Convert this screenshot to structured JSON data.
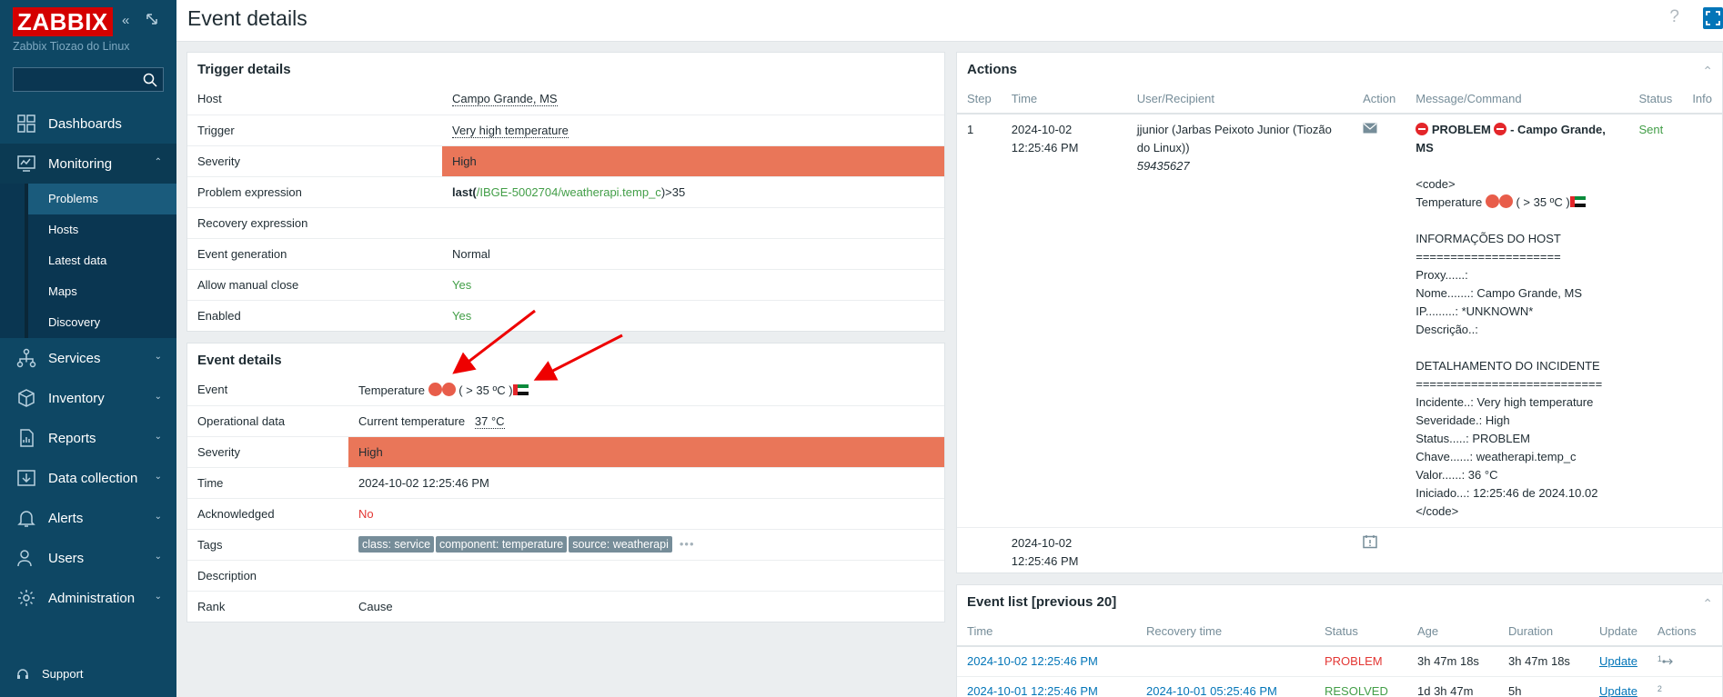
{
  "sidebar": {
    "logo": "ZABBIX",
    "server_name": "Zabbix Tiozao do Linux",
    "search_placeholder": "",
    "menu": [
      {
        "label": "Dashboards",
        "icon": "dashboards-icon"
      },
      {
        "label": "Monitoring",
        "icon": "monitoring-icon"
      },
      {
        "label": "Services",
        "icon": "services-icon"
      },
      {
        "label": "Inventory",
        "icon": "inventory-icon"
      },
      {
        "label": "Reports",
        "icon": "reports-icon"
      },
      {
        "label": "Data collection",
        "icon": "data-collection-icon"
      },
      {
        "label": "Alerts",
        "icon": "alerts-icon"
      },
      {
        "label": "Users",
        "icon": "users-icon"
      },
      {
        "label": "Administration",
        "icon": "administration-icon"
      }
    ],
    "monitoring_sub": [
      "Problems",
      "Hosts",
      "Latest data",
      "Maps",
      "Discovery"
    ],
    "support": "Support"
  },
  "header": {
    "title": "Event details"
  },
  "trigger": {
    "title": "Trigger details",
    "rows": {
      "host_label": "Host",
      "host_value": "Campo Grande, MS",
      "trigger_label": "Trigger",
      "trigger_value": "Very high temperature",
      "severity_label": "Severity",
      "severity_value": "High",
      "expr_label": "Problem expression",
      "expr_fn": "last(",
      "expr_item": "/IBGE-5002704/weatherapi.temp_c",
      "expr_tail": ")>35",
      "recovery_label": "Recovery expression",
      "gen_label": "Event generation",
      "gen_value": "Normal",
      "manual_label": "Allow manual close",
      "manual_value": "Yes",
      "enabled_label": "Enabled",
      "enabled_value": "Yes"
    }
  },
  "event": {
    "title": "Event details",
    "event_label": "Event",
    "event_value_pre": "Temperature",
    "event_value_mid": "( > 35 ºC )",
    "opdata_label": "Operational data",
    "opdata_text": "Current temperature",
    "opdata_value": "37 °C",
    "severity_label": "Severity",
    "severity_value": "High",
    "time_label": "Time",
    "time_value": "2024-10-02 12:25:46 PM",
    "ack_label": "Acknowledged",
    "ack_value": "No",
    "tags_label": "Tags",
    "tags": [
      "class: service",
      "component: temperature",
      "source: weatherapi"
    ],
    "desc_label": "Description",
    "rank_label": "Rank",
    "rank_value": "Cause"
  },
  "actions": {
    "title": "Actions",
    "columns": [
      "Step",
      "Time",
      "User/Recipient",
      "Action",
      "Message/Command",
      "Status",
      "Info"
    ],
    "row1": {
      "step": "1",
      "time": "2024-10-02 12:25:46 PM",
      "user": "jjunior (Jarbas Peixoto Junior (Tiozão do Linux))",
      "user_id": "59435627",
      "msg_title_a": "PROBLEM",
      "msg_title_b": "- Campo Grande, MS",
      "msg_code": "<code>",
      "msg_temp_pre": "Temperature",
      "msg_temp_mid": "( > 35 ºC )",
      "msg_body": "INFORMAÇÕES DO HOST\n=====================\nProxy......:\nNome.......: Campo Grande, MS\nIP.........: *UNKNOWN*\nDescrição..:\n\nDETALHAMENTO DO INCIDENTE\n===========================\nIncidente..: Very high temperature\nSeveridade.: High\nStatus.....: PROBLEM\nChave......: weatherapi.temp_c\nValor......: 36 °C\nIniciado...: 12:25:46 de 2024.10.02\n</code>",
      "status": "Sent"
    },
    "row2": {
      "time": "2024-10-02 12:25:46 PM"
    }
  },
  "eventlist": {
    "title": "Event list [previous 20]",
    "columns": [
      "Time",
      "Recovery time",
      "Status",
      "Age",
      "Duration",
      "Update",
      "Actions"
    ],
    "rows": [
      {
        "time": "2024-10-02 12:25:46 PM",
        "recovery": "",
        "status": "PROBLEM",
        "age": "3h 47m 18s",
        "duration": "3h 47m 18s",
        "update": "Update",
        "actions": "1"
      },
      {
        "time": "2024-10-01 12:25:46 PM",
        "recovery": "2024-10-01 05:25:46 PM",
        "status": "RESOLVED",
        "age": "1d 3h 47m",
        "duration": "5h",
        "update": "Update",
        "actions": "2"
      }
    ]
  },
  "colors": {
    "sidebar": "#0e4764",
    "high": "#e97659",
    "ok": "#429e47",
    "problem": "#e33734",
    "link": "#0275b8"
  }
}
